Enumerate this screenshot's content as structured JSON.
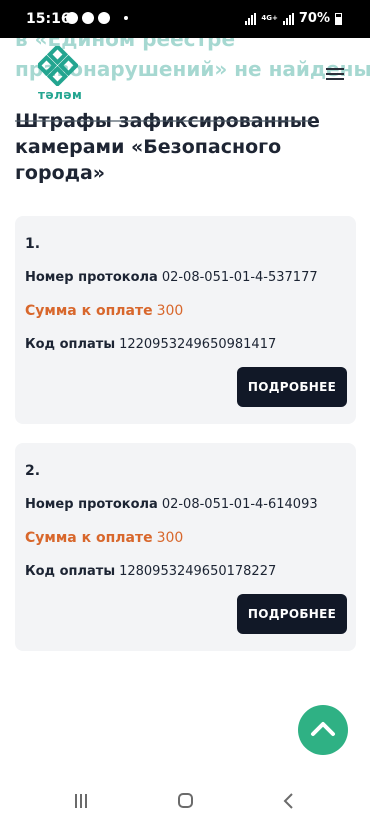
{
  "status_bar": {
    "time": "15:16",
    "network": "4G+",
    "battery": "70%",
    "notification_icons": [
      "whatsapp-icon",
      "chat-icon",
      "account-icon"
    ]
  },
  "header": {
    "background_text_line1": "в «Едином реестре",
    "background_text_line2": "правонарушений» не найдены!",
    "logo_text": "тәләм",
    "menu_icon": "hamburger-icon"
  },
  "page": {
    "title": "Штрафы зафиксированные камерами «Безопасного города»"
  },
  "labels": {
    "protocol": "Номер протокола",
    "sum": "Сумма к оплате",
    "code": "Код оплаты",
    "details_button": "ПОДРОБНЕЕ"
  },
  "fines": [
    {
      "number": "1.",
      "protocol": "02-08-051-01-4-537177",
      "sum": "300",
      "code": "1220953249650981417"
    },
    {
      "number": "2.",
      "protocol": "02-08-051-01-4-614093",
      "sum": "300",
      "code": "1280953249650178227"
    }
  ],
  "colors": {
    "accent_green": "#2fb184",
    "sum_orange": "#d8672c",
    "button_dark": "#111827",
    "card_bg": "#f3f4f6"
  }
}
